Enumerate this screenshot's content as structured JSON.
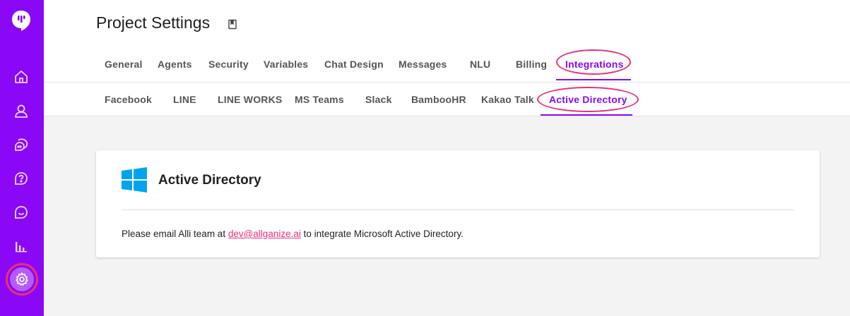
{
  "page": {
    "title": "Project Settings"
  },
  "sidebar": {
    "items": [
      {
        "icon": "home-icon"
      },
      {
        "icon": "user-icon"
      },
      {
        "icon": "conversation-icon"
      },
      {
        "icon": "faq-icon"
      },
      {
        "icon": "chat-icon"
      },
      {
        "icon": "analytics-icon"
      },
      {
        "icon": "settings-icon"
      }
    ]
  },
  "tabs": [
    {
      "label": "General"
    },
    {
      "label": "Agents"
    },
    {
      "label": "Security"
    },
    {
      "label": "Variables"
    },
    {
      "label": "Chat Design"
    },
    {
      "label": "Messages"
    },
    {
      "label": "NLU"
    },
    {
      "label": "Billing"
    },
    {
      "label": "Integrations"
    }
  ],
  "subtabs": [
    {
      "label": "Facebook"
    },
    {
      "label": "LINE"
    },
    {
      "label": "LINE WORKS"
    },
    {
      "label": "MS Teams"
    },
    {
      "label": "Slack"
    },
    {
      "label": "BambooHR"
    },
    {
      "label": "Kakao Talk"
    },
    {
      "label": "Active Directory"
    }
  ],
  "card": {
    "title": "Active Directory",
    "text_before": "Please email Alli team at ",
    "email": "dev@allganize.ai",
    "text_after": " to integrate Microsoft Active Directory."
  },
  "colors": {
    "accent": "#8a08f5",
    "highlight": "#e8307a",
    "windows_blue": "#00a4ef"
  }
}
